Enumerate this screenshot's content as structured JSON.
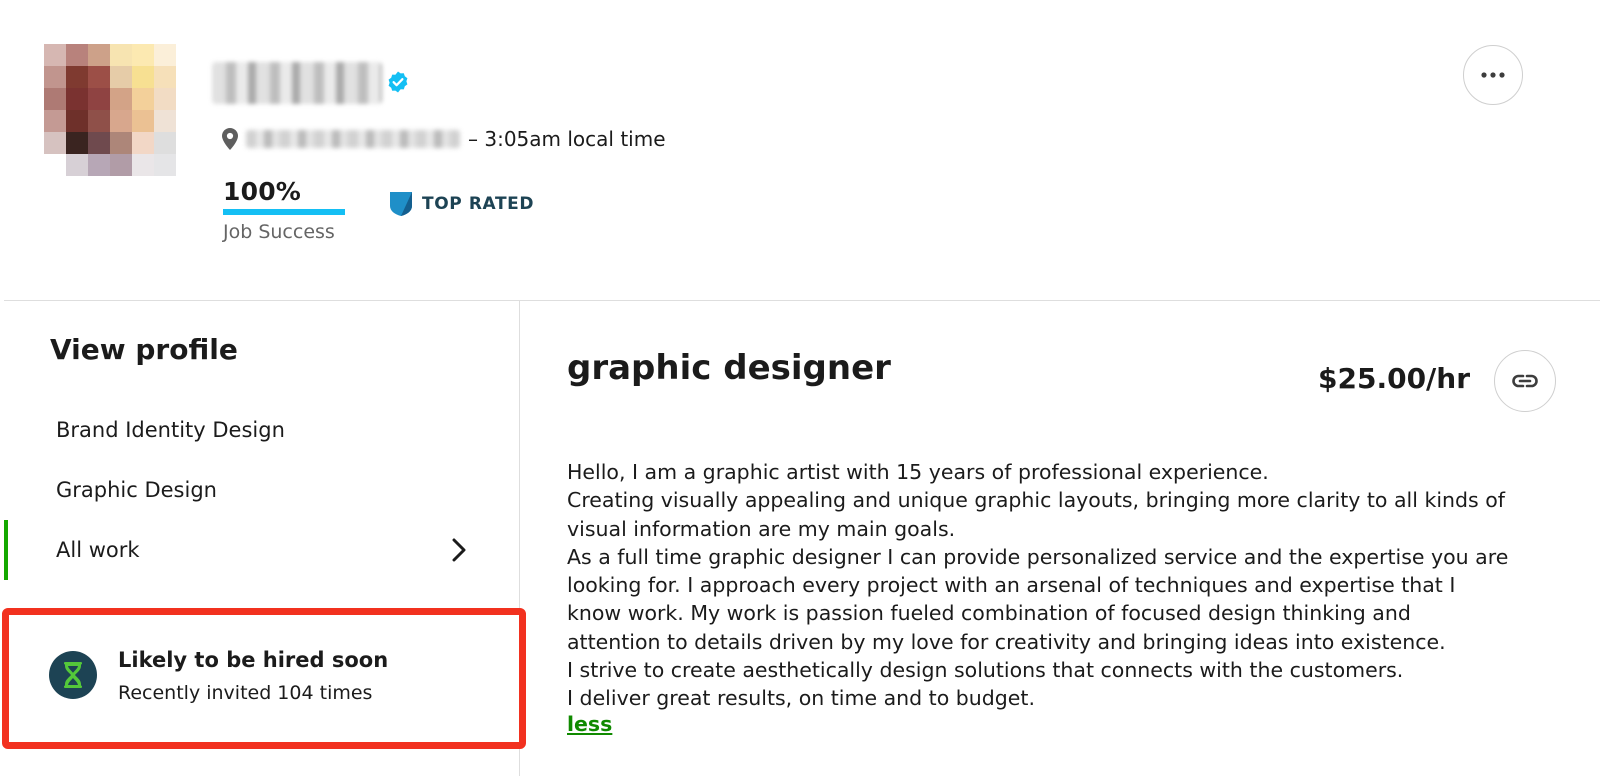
{
  "header": {
    "avatar_colors": [
      "#d6b7b2",
      "#b8827c",
      "#cda189",
      "#f7e4b1",
      "#fce9b1",
      "#fbefd9",
      "#c1958e",
      "#7f3a30",
      "#9c4f47",
      "#e6cca8",
      "#f7e092",
      "#f6e0b9",
      "#ae7a74",
      "#7a3230",
      "#8f4342",
      "#d3a387",
      "#f3d09a",
      "#f2dcc4",
      "#c49a94",
      "#6e302a",
      "#8f5049",
      "#d8a78d",
      "#ebc193",
      "#efe2d6",
      "#d6c2c0",
      "#3a2420",
      "#6f4a4e",
      "#ad8679",
      "#f2d7c6",
      "#dedede",
      "#ffffff",
      "#d7d0d6",
      "#b7a7b6",
      "#b19ca7",
      "#eae6e8",
      "#e5e5e7"
    ],
    "local_time": "– 3:05am local time",
    "job_success_percent": "100%",
    "job_success_value": 1.0,
    "job_success_label": "Job Success",
    "badge_label": "TOP RATED",
    "more_icon": "ellipsis-icon",
    "accent_color": "#14bff4"
  },
  "sidebar": {
    "title": "View profile",
    "items": [
      {
        "label": "Brand Identity Design"
      },
      {
        "label": "Graphic Design"
      },
      {
        "label": "All work"
      }
    ],
    "active_color": "#14a800"
  },
  "hired_card": {
    "title": "Likely to be hired soon",
    "subtitle": "Recently invited 104 times",
    "highlight_color": "#f2311f"
  },
  "main": {
    "title": "graphic designer",
    "rate": "$25.00/hr",
    "description_lines": [
      "Hello, I am a graphic artist with 15 years of professional experience.",
      "Creating visually appealing and unique graphic layouts, bringing more clarity to all kinds of",
      "visual information are my main goals.",
      "As a full time graphic designer I can provide personalized service and the expertise you are",
      "looking for. I approach every project with an arsenal of techniques and expertise that I",
      "know work. My work is passion fueled combination of focused design thinking and",
      "attention to details driven by my love for creativity and bringing ideas into existence.",
      "I strive to create aesthetically design solutions that connects with the customers.",
      "I deliver great results, on time and to budget."
    ],
    "less_label": "less",
    "link_color": "#108a00"
  }
}
